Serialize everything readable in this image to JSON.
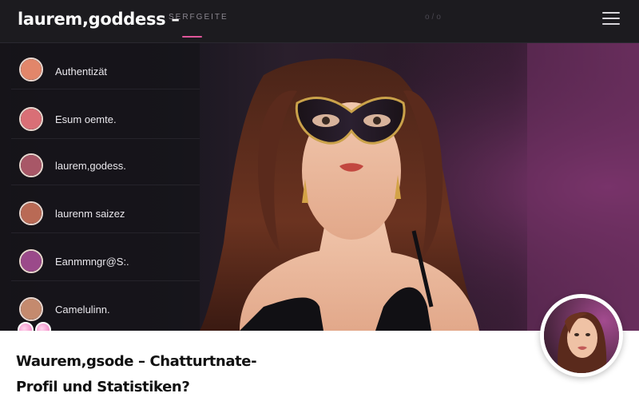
{
  "header": {
    "brand": "laurem,goddess –",
    "nav_tab": "SERFGEITE",
    "nav_dots": "o/o",
    "menu_icon": "hamburger-menu-icon"
  },
  "sidebar": {
    "items": [
      {
        "label": "Authentizät",
        "avatar_color": "#e2866a"
      },
      {
        "label": "Esum oemte.",
        "avatar_color": "#d96f76"
      },
      {
        "label": "laurem,godess.",
        "avatar_color": "#a85767"
      },
      {
        "label": "laurenm saizez",
        "avatar_color": "#b96a55"
      },
      {
        "label": "Eanmmngr@S:.",
        "avatar_color": "#9b4a8a"
      },
      {
        "label": "Camelulinn.",
        "avatar_color": "#c48a6e"
      }
    ]
  },
  "info": {
    "title_line1": "Waurem,gsode – Chatturtnate-",
    "title_line2": "Profil und Statistiken?"
  },
  "colors": {
    "accent": "#e0569a",
    "header_bg": "#1c1b1f",
    "info_bg": "#ffffff"
  }
}
